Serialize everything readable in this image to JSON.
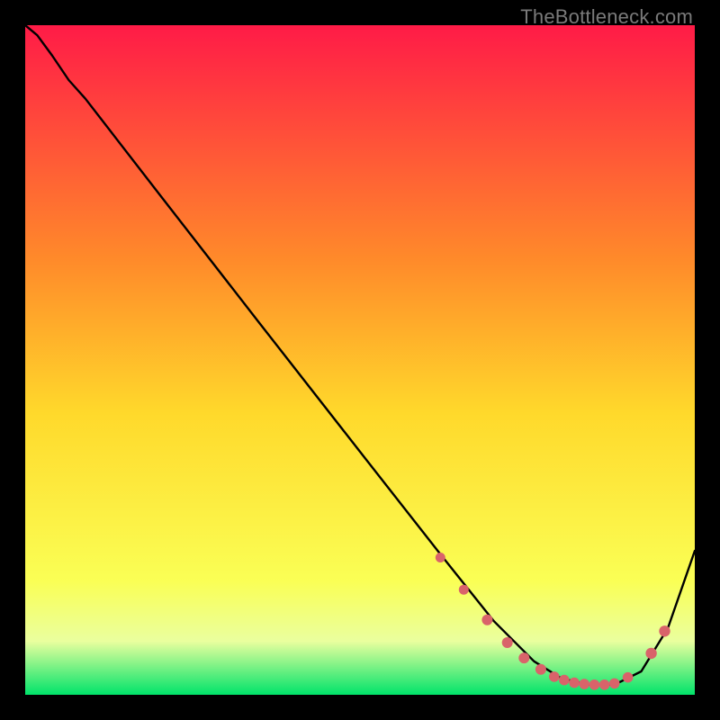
{
  "watermark": "TheBottleneck.com",
  "chart_data": {
    "type": "line",
    "title": "",
    "xlabel": "",
    "ylabel": "",
    "xlim": [
      0,
      1
    ],
    "ylim": [
      0,
      1
    ],
    "background_gradient": {
      "top_color": "#ff1b47",
      "mid_upper": "#ff8a2a",
      "mid": "#ffd92b",
      "mid_lower": "#faff55",
      "bottom_color": "#00e36a"
    },
    "series": [
      {
        "name": "curve",
        "color": "#000000",
        "x": [
          0.0,
          0.018,
          0.04,
          0.065,
          0.09,
          0.2,
          0.35,
          0.5,
          0.62,
          0.7,
          0.76,
          0.8,
          0.84,
          0.88,
          0.92,
          0.96,
          1.0
        ],
        "y": [
          1.0,
          0.985,
          0.955,
          0.918,
          0.89,
          0.748,
          0.555,
          0.363,
          0.21,
          0.11,
          0.05,
          0.025,
          0.015,
          0.015,
          0.035,
          0.1,
          0.215
        ]
      }
    ],
    "marker_region": {
      "color": "#d9636a",
      "x": [
        0.62,
        0.655,
        0.69,
        0.72,
        0.745,
        0.77,
        0.79,
        0.805,
        0.82,
        0.835,
        0.85,
        0.865,
        0.88,
        0.9,
        0.935,
        0.955
      ],
      "y": [
        0.205,
        0.157,
        0.112,
        0.078,
        0.055,
        0.038,
        0.027,
        0.022,
        0.018,
        0.016,
        0.015,
        0.015,
        0.017,
        0.026,
        0.062,
        0.095
      ],
      "r": [
        5.5,
        5.5,
        6.0,
        6.0,
        6.0,
        6.0,
        5.8,
        5.8,
        5.8,
        5.8,
        5.8,
        5.8,
        5.8,
        5.8,
        6.2,
        6.2
      ]
    }
  }
}
